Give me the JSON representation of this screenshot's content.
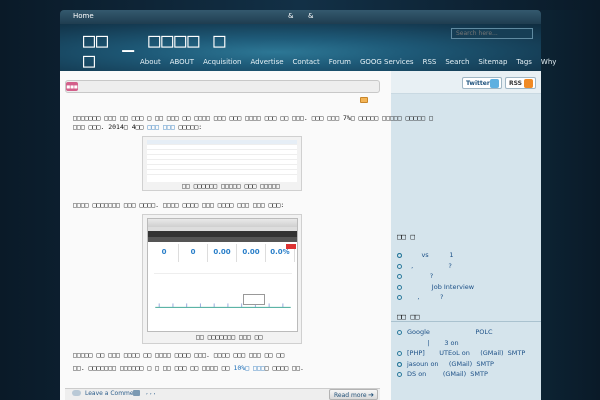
{
  "topbar": {
    "home": "Home",
    "amp1": "&",
    "amp2": "&"
  },
  "header": {
    "title_line1": "□□ _ □□□□ □",
    "title_line2": "□",
    "search_placeholder": "Search here..."
  },
  "nav": [
    "About",
    "ABOUT",
    "Acquisition",
    "Advertise",
    "Contact",
    "Forum",
    "GOOG Services",
    "RSS",
    "Search",
    "Sitemap",
    "Tags",
    "Why"
  ],
  "post": {
    "badge": "■■■",
    "para1_line1": "□□□□□□□ □□□ □□ □□□ □ □□ □□□ □□ □□□□ □□□ □□□ □□□□ □□□ □□ □□□. □□□ □□□ 7%□ □□□□□ □□□□□ □□□□□ □",
    "para1_line2_a": "□□□ □□□. 2014□ 4□□ ",
    "para1_line2_link": "□□□ □□□",
    "para1_line2_b": " □□□□□:",
    "caption1": "□□ □□□□□□ □□□□□ □□□ □□□□□",
    "para2": "□□□□ □□□□□□□ □□□ □□□□. □□□□ □□□□ □□□ □□□□ □□□ □□□ □□□:",
    "stats": [
      "0",
      "0",
      "0.00",
      "0.00",
      "0.0%"
    ],
    "caption2": "□□ □□□□□□□ □□□ □□",
    "para3": "□□□□□ □□ □□□ □□□□ □□ □□□□ □□□□ □□□. □□□□ □□□ □□□ □□ □□",
    "para4_a": "□□. □□□□□□□ □□□□□□ □ □ □□ □□□ □□ □□□□ □□ ",
    "para4_link1": "10%□",
    "para4_mid": " ",
    "para4_link2": "□□□",
    "para4_b": "□ □□□□ □□.",
    "leave_comment": "Leave a Comment",
    "tags": ",   ,   ,",
    "read_more": "Read more",
    "read_more_arrow": "➔"
  },
  "sidebar": {
    "twitter": "Twitter",
    "rss": "RSS",
    "heading1": "□□ □",
    "heading2": "□□ □□",
    "list1": [
      {
        "text": "",
        "cont": false
      },
      {
        "text": "       vs          1",
        "cont": false
      },
      {
        "text": "  ,                 ?",
        "cont": false
      },
      {
        "text": "           ?",
        "cont": false
      },
      {
        "text": "            Job Interview",
        "cont": false
      },
      {
        "text": "     ,          ?",
        "cont": false
      }
    ],
    "list2": [
      {
        "text": "Google                      POLC",
        "cont": false
      },
      {
        "text": "          |       3 on",
        "cont": true
      },
      {
        "text": "[PHP]       UTEoL on     (GMail)  SMTP",
        "cont": false
      },
      {
        "text": "",
        "cont": true
      },
      {
        "text": "",
        "cont": false
      },
      {
        "text": "jasoun on     (GMail)  SMTP",
        "cont": false
      },
      {
        "text": "DS on        (GMail)  SMTP",
        "cont": false
      }
    ]
  }
}
